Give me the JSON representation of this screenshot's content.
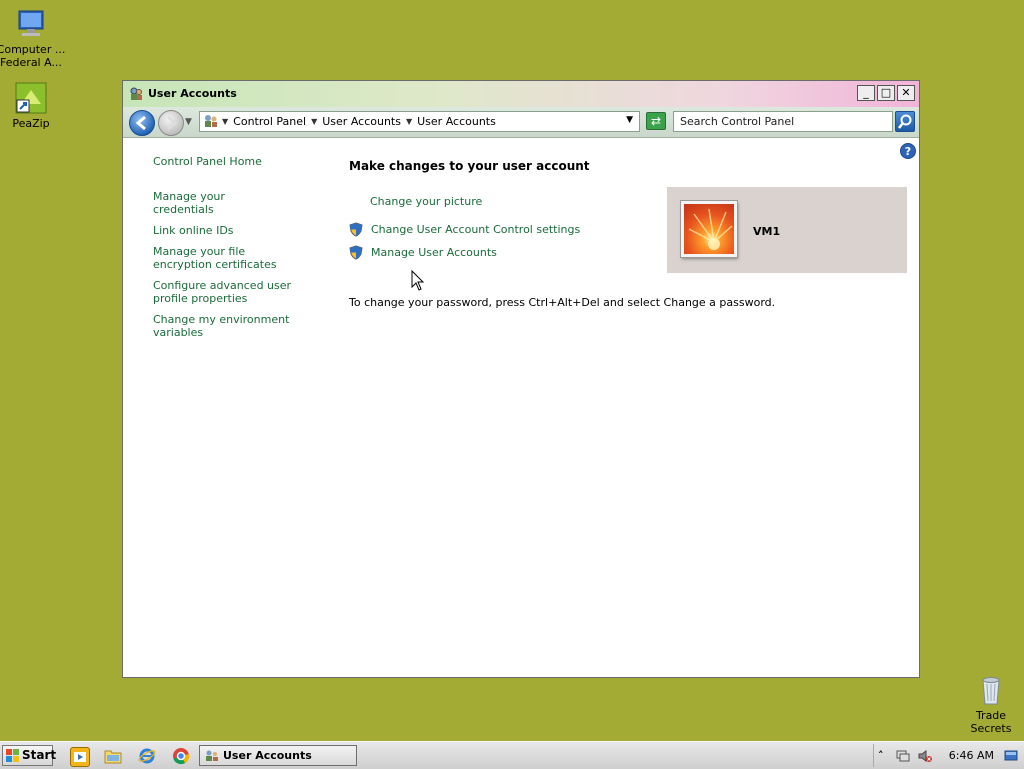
{
  "desktop": {
    "icons": [
      {
        "label_line1": "Computer ...",
        "label_line2": "Federal A...",
        "icon": "computer-icon"
      },
      {
        "label": "PeaZip",
        "icon": "peazip-icon"
      },
      {
        "label_line1": "Trade",
        "label_line2": "Secrets",
        "icon": "recycle-bin-icon"
      }
    ]
  },
  "window": {
    "title": "User Accounts",
    "caption_buttons": {
      "minimize": "_",
      "maximize": "□",
      "close": "✕"
    },
    "address": {
      "breadcrumbs": [
        "Control Panel",
        "User Accounts",
        "User Accounts"
      ]
    },
    "search": {
      "placeholder": "Search Control Panel"
    },
    "help": "?",
    "left_nav": {
      "home": "Control Panel Home",
      "items": [
        "Manage your credentials",
        "Link online IDs",
        "Manage your file encryption certificates",
        "Configure advanced user profile properties",
        "Change my environment variables"
      ]
    },
    "content": {
      "heading": "Make changes to your user account",
      "tasks": [
        {
          "label": "Change your picture",
          "shield": false
        },
        {
          "label": "Change User Account Control settings",
          "shield": true
        },
        {
          "label": "Manage User Accounts",
          "shield": true
        }
      ],
      "account_name": "VM1",
      "password_note": "To change your password, press Ctrl+Alt+Del and select Change a password."
    }
  },
  "taskbar": {
    "start_label": "Start",
    "active_task": "User Accounts",
    "clock": "6:46 AM",
    "quick_launch": [
      "media-player-icon",
      "file-explorer-icon",
      "internet-explorer-icon",
      "chrome-icon"
    ],
    "tray_icons": [
      "show-hidden-icons-chevron",
      "network-icon",
      "volume-muted-icon",
      "show-desktop-icon"
    ]
  },
  "colors": {
    "desktop": "#a3ab34",
    "link": "#1a6b3b"
  }
}
